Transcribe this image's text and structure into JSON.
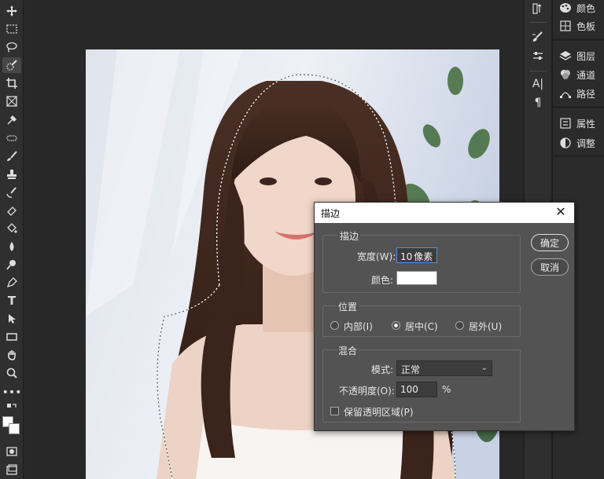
{
  "right_panel": {
    "items": [
      {
        "label": "颜色",
        "icon": "palette-icon"
      },
      {
        "label": "色板",
        "icon": "swatches-icon"
      },
      {
        "label": "图层",
        "icon": "layers-icon"
      },
      {
        "label": "通道",
        "icon": "channels-icon"
      },
      {
        "label": "路径",
        "icon": "paths-icon"
      },
      {
        "label": "属性",
        "icon": "properties-icon"
      },
      {
        "label": "调整",
        "icon": "adjustments-icon"
      }
    ]
  },
  "dialog": {
    "title": "描边",
    "close_glyph": "✕",
    "stroke": {
      "group_label": "描边",
      "width_label": "宽度(W):",
      "width_value": "10",
      "width_unit": "像素",
      "color_label": "颜色:",
      "color_value": "#ffffff"
    },
    "location": {
      "group_label": "位置",
      "options": [
        "内部(I)",
        "居中(C)",
        "居外(U)"
      ],
      "selected": "居中(C)"
    },
    "blending": {
      "group_label": "混合",
      "mode_label": "模式:",
      "mode_value": "正常",
      "opacity_label": "不透明度(O):",
      "opacity_value": "100",
      "opacity_unit": "%",
      "preserve_label": "保留透明区域(P)",
      "preserve_checked": false
    },
    "ok_label": "确定",
    "cancel_label": "取消"
  },
  "colors": {
    "accent_arrow": "#e04a2a",
    "dialog_bg": "#535353",
    "focus_border": "#5b8fd6"
  }
}
